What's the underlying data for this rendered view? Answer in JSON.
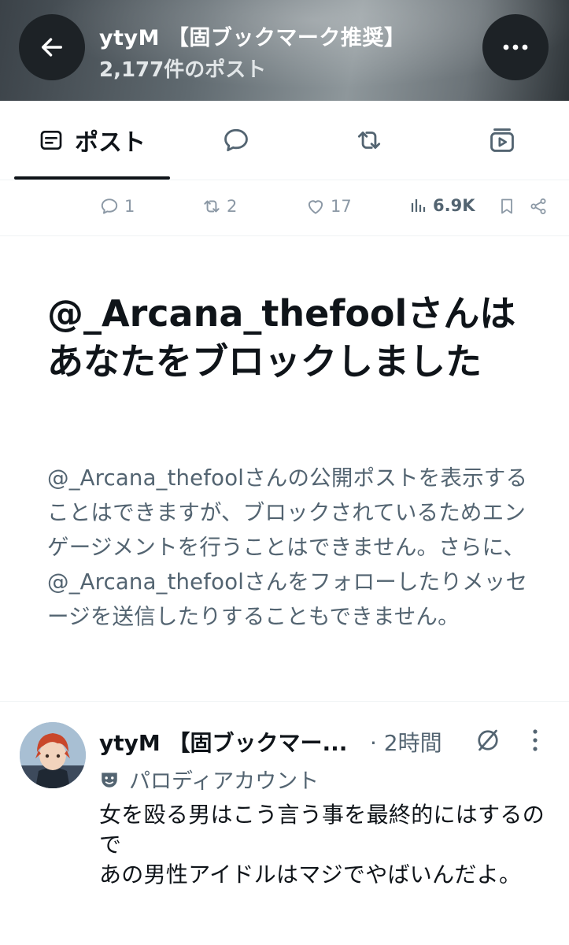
{
  "header": {
    "title": "ytyM 【固ブックマーク推奨】",
    "post_count": "2,177件のポスト"
  },
  "tabs": [
    {
      "label": "ポスト",
      "icon": "post-icon",
      "selected": true
    },
    {
      "label": "",
      "icon": "reply-bubble-icon"
    },
    {
      "label": "",
      "icon": "repost-icon"
    },
    {
      "label": "",
      "icon": "media-icon"
    }
  ],
  "engagement": {
    "replies": "1",
    "reposts": "2",
    "likes": "17",
    "views": "6.9K"
  },
  "blocked": {
    "title": "@_Arcana_thefoolさんはあなたをブロックしました",
    "body": "@_Arcana_thefoolさんの公開ポストを表示することはできますが、ブロックされているためエンゲージメントを行うことはできません。さらに、@_Arcana_thefoolさんをフォローしたりメッセージを送信したりすることもできません。"
  },
  "tweet": {
    "name": "ytyM 【固ブックマー...",
    "time": "· 2時間",
    "label": "パロディアカウント",
    "text": "女を殴る男はこう言う事を最終的にはするので\nあの男性アイドルはマジでやばいんだよ。"
  },
  "colors": {
    "text_primary": "#0f1419",
    "text_secondary": "#536471",
    "icon_muted": "#8b98a5",
    "divider": "#eff3f4"
  }
}
